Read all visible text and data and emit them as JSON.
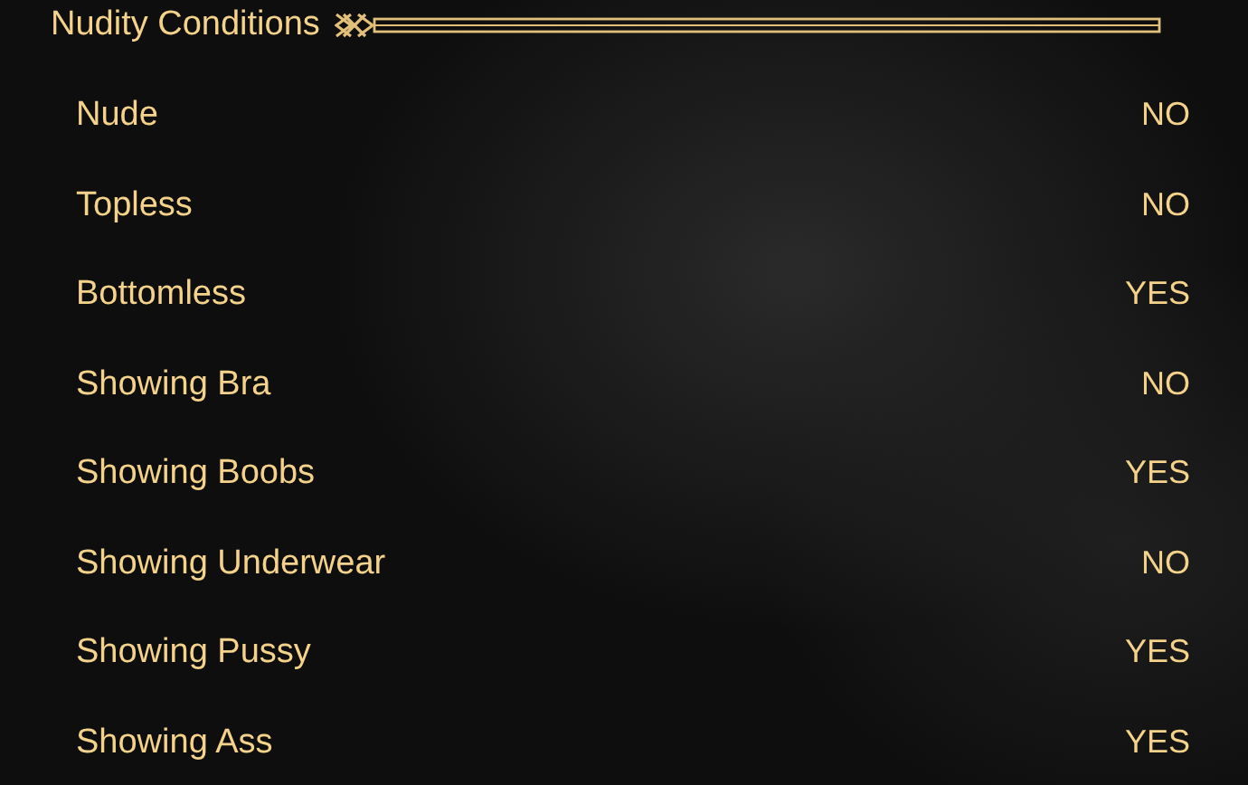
{
  "header": {
    "title": "Nudity Conditions"
  },
  "options": [
    {
      "label": "Nude",
      "value": "NO"
    },
    {
      "label": "Topless",
      "value": "NO"
    },
    {
      "label": "Bottomless",
      "value": "YES"
    },
    {
      "label": "Showing Bra",
      "value": "NO"
    },
    {
      "label": "Showing Boobs",
      "value": "YES"
    },
    {
      "label": "Showing Underwear",
      "value": "NO"
    },
    {
      "label": "Showing Pussy",
      "value": "YES"
    },
    {
      "label": "Showing Ass",
      "value": "YES"
    }
  ]
}
